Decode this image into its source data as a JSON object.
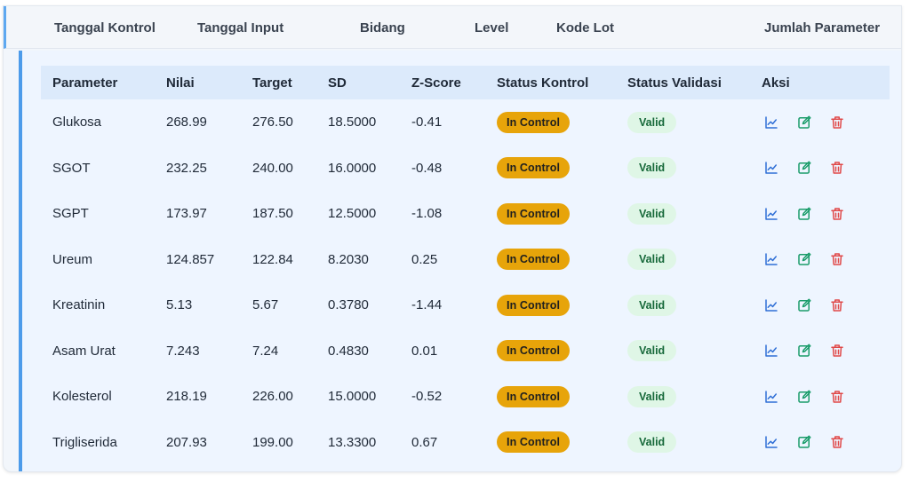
{
  "header": {
    "tanggal_kontrol": "Tanggal Kontrol",
    "tanggal_input": "Tanggal Input",
    "bidang": "Bidang",
    "level": "Level",
    "kode_lot": "Kode Lot",
    "jumlah_parameter": "Jumlah Parameter"
  },
  "table": {
    "columns": [
      "Parameter",
      "Nilai",
      "Target",
      "SD",
      "Z-Score",
      "Status Kontrol",
      "Status Validasi",
      "Aksi"
    ],
    "rows": [
      {
        "parameter": "Glukosa",
        "nilai": "268.99",
        "target": "276.50",
        "sd": "18.5000",
        "z": "-0.41",
        "kontrol": "In Control",
        "validasi": "Valid"
      },
      {
        "parameter": "SGOT",
        "nilai": "232.25",
        "target": "240.00",
        "sd": "16.0000",
        "z": "-0.48",
        "kontrol": "In Control",
        "validasi": "Valid"
      },
      {
        "parameter": "SGPT",
        "nilai": "173.97",
        "target": "187.50",
        "sd": "12.5000",
        "z": "-1.08",
        "kontrol": "In Control",
        "validasi": "Valid"
      },
      {
        "parameter": "Ureum",
        "nilai": "124.857",
        "target": "122.84",
        "sd": "8.2030",
        "z": "0.25",
        "kontrol": "In Control",
        "validasi": "Valid"
      },
      {
        "parameter": "Kreatinin",
        "nilai": "5.13",
        "target": "5.67",
        "sd": "0.3780",
        "z": "-1.44",
        "kontrol": "In Control",
        "validasi": "Valid"
      },
      {
        "parameter": "Asam Urat",
        "nilai": "7.243",
        "target": "7.24",
        "sd": "0.4830",
        "z": "0.01",
        "kontrol": "In Control",
        "validasi": "Valid"
      },
      {
        "parameter": "Kolesterol",
        "nilai": "218.19",
        "target": "226.00",
        "sd": "15.0000",
        "z": "-0.52",
        "kontrol": "In Control",
        "validasi": "Valid"
      },
      {
        "parameter": "Trigliserida",
        "nilai": "207.93",
        "target": "199.00",
        "sd": "13.3300",
        "z": "0.67",
        "kontrol": "In Control",
        "validasi": "Valid"
      }
    ]
  },
  "icons": {
    "chart": "chart-icon",
    "edit": "edit-icon",
    "delete": "trash-icon"
  },
  "colors": {
    "in_control": "#e7a40a",
    "valid_bg": "#dff6e6",
    "accent": "#4c9bea",
    "chart": "#2f6fd6",
    "edit": "#1a9c6a",
    "delete": "#e04848"
  }
}
